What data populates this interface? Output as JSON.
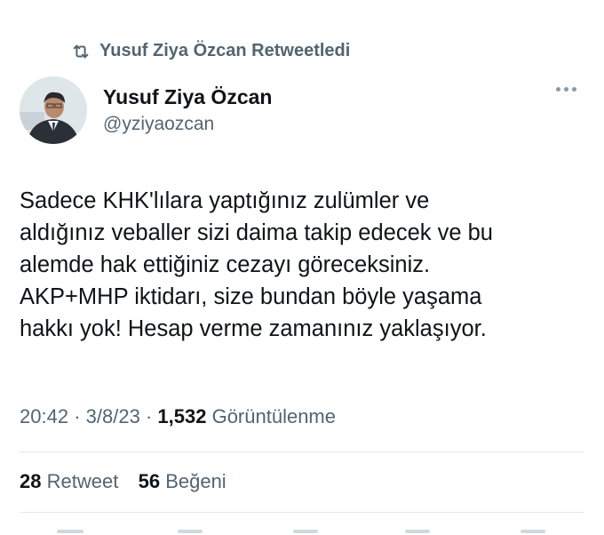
{
  "retweet": {
    "icon": "retweet-icon",
    "label": "Yusuf Ziya Özcan Retweetledi"
  },
  "author": {
    "name": "Yusuf Ziya Özcan",
    "handle": "@yziyaozcan"
  },
  "tweet": {
    "lines": [
      "Sadece KHK'lılara yaptığınız zulümler ve",
      "aldığınız veballer sizi daima takip edecek ve bu",
      "alemde hak ettiğiniz cezayı göreceksiniz.",
      "AKP+MHP iktidarı, size bundan böyle yaşama",
      "hakkı yok! Hesap verme zamanınız yaklaşıyor."
    ]
  },
  "meta": {
    "time": "20:42",
    "date": "3/8/23",
    "views": "1,532",
    "views_label": "Görüntülenme"
  },
  "stats": {
    "retweets": "28",
    "retweets_label": "Retweet",
    "likes": "56",
    "likes_label": "Beğeni"
  },
  "colors": {
    "secondary_text": "#536471",
    "primary_text": "#0f1419",
    "divider": "#e1e8ed"
  }
}
